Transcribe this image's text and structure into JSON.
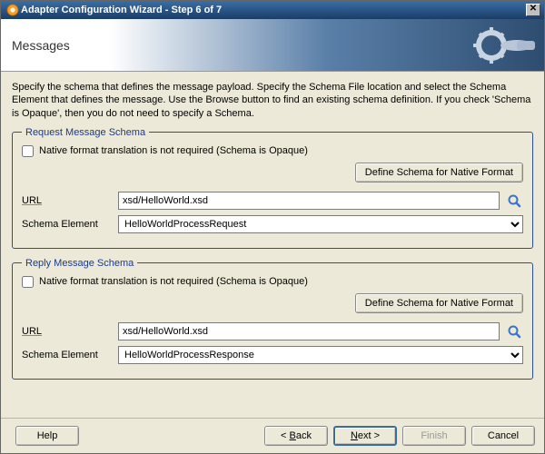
{
  "window": {
    "title": "Adapter Configuration Wizard - Step 6 of 7"
  },
  "header": {
    "page_title": "Messages"
  },
  "description": "Specify the schema that defines the message payload.  Specify the Schema File location and select the Schema Element that defines the message. Use the Browse button to find an existing schema definition. If you check 'Schema is Opaque', then you do not need to specify a Schema.",
  "request": {
    "legend": "Request Message Schema",
    "opaque_label": "Native format translation is not required (Schema is Opaque)",
    "define_btn": "Define Schema for Native Format",
    "url_label": "URL",
    "url_value": "xsd/HelloWorld.xsd",
    "element_label": "Schema Element",
    "element_value": "HelloWorldProcessRequest"
  },
  "reply": {
    "legend": "Reply Message Schema",
    "opaque_label": "Native format translation is not required (Schema is Opaque)",
    "define_btn": "Define Schema for Native Format",
    "url_label": "URL",
    "url_value": "xsd/HelloWorld.xsd",
    "element_label": "Schema Element",
    "element_value": "HelloWorldProcessResponse"
  },
  "footer": {
    "help": "Help",
    "back": "< Back",
    "next": "Next >",
    "finish": "Finish",
    "cancel": "Cancel"
  }
}
